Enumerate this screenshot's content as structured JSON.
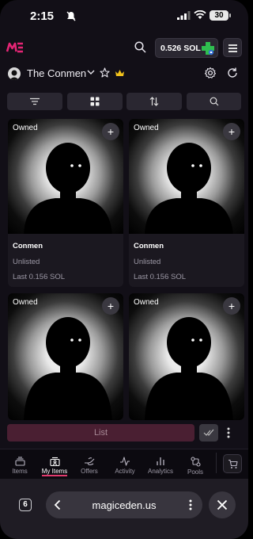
{
  "status_bar": {
    "time": "2:15",
    "battery": "30",
    "icons": [
      "bell-muted-icon",
      "signal-icon",
      "wifi-icon",
      "battery-icon"
    ]
  },
  "header": {
    "logo": "ME",
    "wallet_balance": "0.526 SOL",
    "icons": [
      "search-icon",
      "wallet-avatar-icon",
      "menu-icon"
    ]
  },
  "collection": {
    "name": "The Conmen",
    "icons": [
      "chevron-down-icon",
      "star-icon",
      "crown-icon",
      "gear-icon",
      "refresh-icon"
    ]
  },
  "toolbar": {
    "icons": [
      "filter-icon",
      "grid-icon",
      "sort-icon",
      "search-icon"
    ]
  },
  "cards": [
    {
      "owned": "Owned",
      "name": "Conmen",
      "status": "Unlisted",
      "last": "Last 0.156 SOL"
    },
    {
      "owned": "Owned",
      "name": "Conmen",
      "status": "Unlisted",
      "last": "Last 0.156 SOL"
    },
    {
      "owned": "Owned",
      "name": "",
      "status": "",
      "last": ""
    },
    {
      "owned": "Owned",
      "name": "",
      "status": "",
      "last": ""
    }
  ],
  "list_bar": {
    "list_label": "List"
  },
  "tabs": [
    {
      "label": "Items",
      "icon": "stack-icon"
    },
    {
      "label": "My Items",
      "icon": "person-stack-icon"
    },
    {
      "label": "Offers",
      "icon": "hand-icon"
    },
    {
      "label": "Activity",
      "icon": "activity-icon"
    },
    {
      "label": "Analytics",
      "icon": "bar-chart-icon"
    },
    {
      "label": "Pools",
      "icon": "pools-icon"
    }
  ],
  "active_tab": "My Items",
  "browser": {
    "tab_count": "6",
    "url": "magiceden.us"
  },
  "colors": {
    "accent": "#e23b6e",
    "background": "#120f17",
    "list_button": "#4a1f32"
  }
}
